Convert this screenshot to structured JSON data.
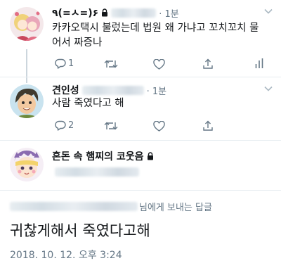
{
  "tweet1": {
    "display_name": "٩(=ㅅ=)۶",
    "time": "· 1분",
    "text_line1": "카카오택시 불렀는데 법원 왜 가냐고 꼬치꼬치 물",
    "text_line2": "어서 짜증나",
    "reply_count": "1"
  },
  "tweet2": {
    "display_name": "견인성",
    "time": "· 1분",
    "text": "사람 죽였다고 해",
    "reply_count": "2"
  },
  "tweet3": {
    "display_name": "혼돈 속 햄찌의 코웃음"
  },
  "reply_to_suffix": "님에게 보내는 답글",
  "main_text": "귀찮게해서 죽였다고해",
  "timestamp": "2018. 10. 12. 오후 3:24"
}
